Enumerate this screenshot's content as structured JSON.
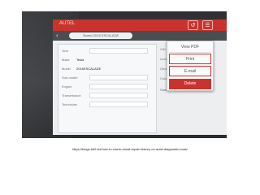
{
  "app": {
    "brand": "AUTEL"
  },
  "toolbar": {
    "button_one_icon": "share-icon",
    "button_two_icon": "settings-icon"
  },
  "header": {
    "title": "Stored 2016 ESCALADE"
  },
  "vehicle_form": {
    "rows": [
      {
        "label": "Year",
        "value": ""
      },
      {
        "label": "Make",
        "value": "Tesla"
      },
      {
        "label": "Model",
        "value": "2016ESCALADE"
      },
      {
        "label": "Sub-model",
        "value": ""
      },
      {
        "label": "Engine",
        "value": ""
      },
      {
        "label": "Transmission",
        "value": ""
      },
      {
        "label": "Technician",
        "value": ""
      }
    ]
  },
  "status_panel": {
    "rows": [
      {
        "label": "VIN",
        "value": ""
      },
      {
        "label": "License",
        "value": ""
      },
      {
        "label": "Odometer Mileage",
        "value": ""
      },
      {
        "label": "Color",
        "value": ""
      },
      {
        "label": "Status",
        "value": "Not started"
      }
    ]
  },
  "context_menu": {
    "items": [
      "View PDF",
      "Print",
      "E-mail",
      "Delete"
    ]
  },
  "caption": "https://blogs.bit2.biz/how-to-check-email-repair-history-on-autel-diagnostic-tools/"
}
